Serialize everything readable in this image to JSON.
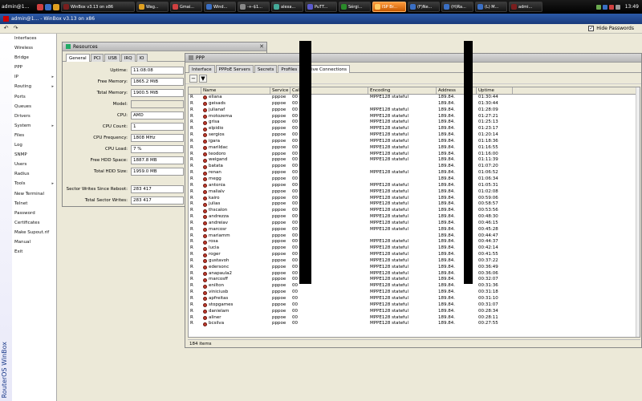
{
  "taskbar": {
    "user": "admin@1…",
    "clock": "13:49",
    "buttons": [
      {
        "label": "WinBox v3.13 on x86",
        "color": "#7a1e1e",
        "active": false,
        "width": 92
      },
      {
        "label": "Wag...",
        "color": "#e0a020",
        "active": false,
        "width": 40
      },
      {
        "label": "Gmai...",
        "color": "#d04040",
        "active": false,
        "width": 40
      },
      {
        "label": "Wind...",
        "color": "#3a6fc4",
        "active": false,
        "width": 40
      },
      {
        "label": "-+-$1...",
        "color": "#888",
        "active": false,
        "width": 40
      },
      {
        "label": "alexa...",
        "color": "#4a9",
        "active": false,
        "width": 40
      },
      {
        "label": "PuTT...",
        "color": "#5a5acc",
        "active": false,
        "width": 40
      },
      {
        "label": "Sérgi...",
        "color": "#2a8a2a",
        "active": false,
        "width": 40
      },
      {
        "label": "ISP Br...",
        "color": "#ffcc66",
        "active": true,
        "width": 42
      },
      {
        "label": "(F)Ne...",
        "color": "#3a6fc4",
        "active": false,
        "width": 40
      },
      {
        "label": "(H)Ra...",
        "color": "#3a6fc4",
        "active": false,
        "width": 40
      },
      {
        "label": "(L) M...",
        "color": "#3a6fc4",
        "active": false,
        "width": 40
      },
      {
        "label": "admi...",
        "color": "#7a1e1e",
        "active": false,
        "width": 42
      }
    ]
  },
  "window": {
    "title": "admin@1...  - WinBox v3.13 on x86",
    "hide_passwords": "Hide Passwords",
    "hide_passwords_checked": "✓"
  },
  "brand": "RouterOS WinBox",
  "menu": [
    {
      "label": "Interfaces",
      "arrow": ""
    },
    {
      "label": "Wireless",
      "arrow": ""
    },
    {
      "label": "Bridge",
      "arrow": ""
    },
    {
      "label": "PPP",
      "arrow": ""
    },
    {
      "label": "IP",
      "arrow": "▸"
    },
    {
      "label": "Routing",
      "arrow": "▸"
    },
    {
      "label": "Ports",
      "arrow": ""
    },
    {
      "label": "Queues",
      "arrow": ""
    },
    {
      "label": "Drivers",
      "arrow": ""
    },
    {
      "label": "System",
      "arrow": "▸"
    },
    {
      "label": "Files",
      "arrow": ""
    },
    {
      "label": "Log",
      "arrow": ""
    },
    {
      "label": "SNMP",
      "arrow": ""
    },
    {
      "label": "Users",
      "arrow": ""
    },
    {
      "label": "Radius",
      "arrow": ""
    },
    {
      "label": "Tools",
      "arrow": "▸"
    },
    {
      "label": "New Terminal",
      "arrow": ""
    },
    {
      "label": "Telnet",
      "arrow": ""
    },
    {
      "label": "Password",
      "arrow": ""
    },
    {
      "label": "Certificates",
      "arrow": ""
    },
    {
      "label": "Make Supout.rif",
      "arrow": ""
    },
    {
      "label": "Manual",
      "arrow": ""
    },
    {
      "label": "Exit",
      "arrow": ""
    }
  ],
  "resources": {
    "title": "Resources",
    "tabs": [
      "General",
      "PCI",
      "USB",
      "IRQ",
      "IO"
    ],
    "fields": [
      {
        "label": "Uptime:",
        "value": "11:08:08"
      },
      {
        "label": "Free Memory:",
        "value": "1865.2 MiB"
      },
      {
        "label": "Total Memory:",
        "value": "1900.5 MiB"
      },
      {
        "label": "Model:",
        "value": ""
      },
      {
        "label": "CPU:",
        "value": "AMD"
      },
      {
        "label": "CPU Count:",
        "value": "1"
      },
      {
        "label": "CPU Frequency:",
        "value": "1808 MHz"
      },
      {
        "label": "CPU Load:",
        "value": "7 %"
      },
      {
        "label": "Free HDD Space:",
        "value": "1887.8 MB"
      },
      {
        "label": "Total HDD Size:",
        "value": "1959.0 MB"
      },
      {
        "label": "",
        "value": null
      },
      {
        "label": "Sector Writes Since Reboot:",
        "value": "283 417"
      },
      {
        "label": "Total Sector Writes:",
        "value": "283 417"
      }
    ]
  },
  "ppp": {
    "title": "PPP",
    "tabs": [
      "Interface",
      "PPPoE Servers",
      "Secrets",
      "Profiles",
      "Active Connections"
    ],
    "active_tab": "Active Connections",
    "columns": [
      "",
      "Name",
      "Service",
      "Caller ID",
      "Encoding",
      "Address",
      "Uptime"
    ],
    "rows": [
      {
        "f": "R",
        "name": "eliana",
        "svc": "pppoe",
        "cid": "00",
        "enc": "MPPE128 stateful",
        "addr": "189.84.",
        "up": "01:30:44"
      },
      {
        "f": "R",
        "name": "geisads",
        "svc": "pppoe",
        "cid": "00",
        "enc": "",
        "addr": "189.84.",
        "up": "01:30:44"
      },
      {
        "f": "R",
        "name": "julianaf",
        "svc": "pppoe",
        "cid": "00",
        "enc": "MPPE128 stateful",
        "addr": "189.84.",
        "up": "01:28:09"
      },
      {
        "f": "R",
        "name": "motozema",
        "svc": "pppoe",
        "cid": "00",
        "enc": "MPPE128 stateful",
        "addr": "189.84.",
        "up": "01:27:21"
      },
      {
        "f": "R",
        "name": "grisa",
        "svc": "pppoe",
        "cid": "00",
        "enc": "MPPE128 stateful",
        "addr": "189.84.",
        "up": "01:25:13"
      },
      {
        "f": "R",
        "name": "elpidio",
        "svc": "pppoe",
        "cid": "00",
        "enc": "MPPE128 stateful",
        "addr": "189.84.",
        "up": "01:23:17"
      },
      {
        "f": "R",
        "name": "sergios",
        "svc": "pppoe",
        "cid": "00",
        "enc": "MPPE128 stateful",
        "addr": "189.84.",
        "up": "01:20:14"
      },
      {
        "f": "R",
        "name": "igara",
        "svc": "pppoe",
        "cid": "00",
        "enc": "MPPE128 stateful",
        "addr": "189.84.",
        "up": "01:18:36"
      },
      {
        "f": "R",
        "name": "marildac",
        "svc": "pppoe",
        "cid": "00",
        "enc": "MPPE128 stateful",
        "addr": "189.84.",
        "up": "01:16:55"
      },
      {
        "f": "R",
        "name": "teodoro",
        "svc": "pppoe",
        "cid": "00",
        "enc": "MPPE128 stateful",
        "addr": "189.84.",
        "up": "01:16:00"
      },
      {
        "f": "R",
        "name": "weigand",
        "svc": "pppoe",
        "cid": "00",
        "enc": "MPPE128 stateful",
        "addr": "189.84.",
        "up": "01:11:39"
      },
      {
        "f": "R",
        "name": "batata",
        "svc": "pppoe",
        "cid": "00",
        "enc": "",
        "addr": "189.84.",
        "up": "01:07:20"
      },
      {
        "f": "R",
        "name": "renan",
        "svc": "pppoe",
        "cid": "00",
        "enc": "MPPE128 stateful",
        "addr": "189.84.",
        "up": "01:06:52"
      },
      {
        "f": "R",
        "name": "megg",
        "svc": "pppoe",
        "cid": "00",
        "enc": "",
        "addr": "189.84.",
        "up": "01:06:34"
      },
      {
        "f": "R",
        "name": "antonia",
        "svc": "pppoe",
        "cid": "00",
        "enc": "MPPE128 stateful",
        "addr": "189.84.",
        "up": "01:05:31"
      },
      {
        "f": "R",
        "name": "malialv",
        "svc": "pppoe",
        "cid": "00",
        "enc": "MPPE128 stateful",
        "addr": "189.84.",
        "up": "01:02:08"
      },
      {
        "f": "R",
        "name": "kairo",
        "svc": "pppoe",
        "cid": "00",
        "enc": "MPPE128 stateful",
        "addr": "189.84.",
        "up": "00:59:06"
      },
      {
        "f": "R",
        "name": "julias",
        "svc": "pppoe",
        "cid": "00",
        "enc": "MPPE128 stateful",
        "addr": "189.84.",
        "up": "00:58:57"
      },
      {
        "f": "R",
        "name": "thscalon",
        "svc": "pppoe",
        "cid": "00",
        "enc": "MPPE128 stateful",
        "addr": "189.84.",
        "up": "00:53:56"
      },
      {
        "f": "R",
        "name": "andrezza",
        "svc": "pppoe",
        "cid": "00",
        "enc": "MPPE128 stateful",
        "addr": "189.84.",
        "up": "00:48:30"
      },
      {
        "f": "R",
        "name": "andreiav",
        "svc": "pppoe",
        "cid": "00",
        "enc": "MPPE128 stateful",
        "addr": "189.84.",
        "up": "00:46:15"
      },
      {
        "f": "R",
        "name": "marcosr",
        "svc": "pppoe",
        "cid": "00",
        "enc": "MPPE128 stateful",
        "addr": "189.84.",
        "up": "00:45:28"
      },
      {
        "f": "R",
        "name": "mariamm",
        "svc": "pppoe",
        "cid": "00",
        "enc": "",
        "addr": "189.84.",
        "up": "00:44:47"
      },
      {
        "f": "R",
        "name": "rosa",
        "svc": "pppoe",
        "cid": "00",
        "enc": "MPPE128 stateful",
        "addr": "189.84.",
        "up": "00:44:37"
      },
      {
        "f": "R",
        "name": "lucia",
        "svc": "pppoe",
        "cid": "00",
        "enc": "MPPE128 stateful",
        "addr": "189.84.",
        "up": "00:42:14"
      },
      {
        "f": "R",
        "name": "roger",
        "svc": "pppoe",
        "cid": "00",
        "enc": "MPPE128 stateful",
        "addr": "189.84.",
        "up": "00:41:55"
      },
      {
        "f": "R",
        "name": "gustavoh",
        "svc": "pppoe",
        "cid": "00",
        "enc": "MPPE128 stateful",
        "addr": "189.84.",
        "up": "00:37:22"
      },
      {
        "f": "R",
        "name": "edersonc",
        "svc": "pppoe",
        "cid": "00",
        "enc": "MPPE128 stateful",
        "addr": "189.84.",
        "up": "00:36:49"
      },
      {
        "f": "R",
        "name": "anapaula2",
        "svc": "pppoe",
        "cid": "00",
        "enc": "MPPE128 stateful",
        "addr": "189.84.",
        "up": "00:36:06"
      },
      {
        "f": "R",
        "name": "marcosff",
        "svc": "pppoe",
        "cid": "00",
        "enc": "MPPE128 stateful",
        "addr": "189.84.",
        "up": "00:32:07"
      },
      {
        "f": "R",
        "name": "enilton",
        "svc": "pppoe",
        "cid": "00",
        "enc": "MPPE128 stateful",
        "addr": "189.84.",
        "up": "00:31:36"
      },
      {
        "f": "R",
        "name": "viniciusb",
        "svc": "pppoe",
        "cid": "00",
        "enc": "MPPE128 stateful",
        "addr": "189.84.",
        "up": "00:31:18"
      },
      {
        "f": "R",
        "name": "apfreitas",
        "svc": "pppoe",
        "cid": "00",
        "enc": "MPPE128 stateful",
        "addr": "189.84.",
        "up": "00:31:10"
      },
      {
        "f": "R",
        "name": "stopgames",
        "svc": "pppoe",
        "cid": "00",
        "enc": "MPPE128 stateful",
        "addr": "189.84.",
        "up": "00:31:07"
      },
      {
        "f": "R",
        "name": "danielam",
        "svc": "pppoe",
        "cid": "00",
        "enc": "MPPE128 stateful",
        "addr": "189.84.",
        "up": "00:28:34"
      },
      {
        "f": "R",
        "name": "aliner",
        "svc": "pppoe",
        "cid": "00",
        "enc": "MPPE128 stateful",
        "addr": "189.84.",
        "up": "00:28:11"
      },
      {
        "f": "R",
        "name": "bcsilva",
        "svc": "pppoe",
        "cid": "00",
        "enc": "MPPE128 stateful",
        "addr": "189.84.",
        "up": "00:27:55"
      }
    ],
    "status": "184 items"
  }
}
